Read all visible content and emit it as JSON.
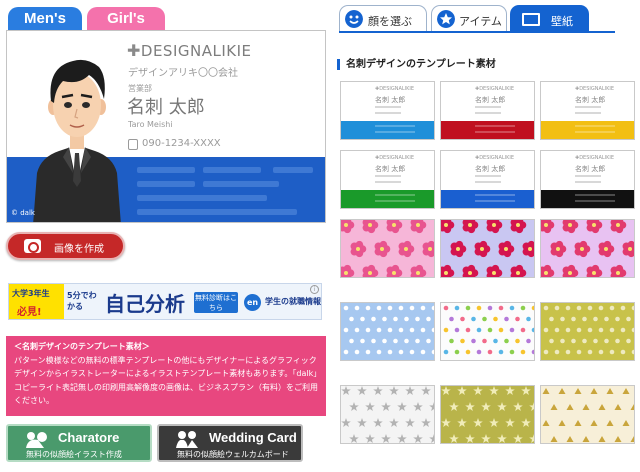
{
  "gender_tabs": {
    "men": "Men's",
    "girl": "Girl's"
  },
  "card": {
    "logo": "DESIGNALIKIE",
    "company": "デザインアリキ〇〇会社",
    "department": "営業部",
    "name": "名刺 太郎",
    "name_roman": "Taro Meishi",
    "tel": "090-1234-XXXX",
    "copyright": "© dalk",
    "band_color": "#1e5ec6"
  },
  "create_button": "画像を作成",
  "banner": {
    "badge_line1": "大学3年生",
    "badge_line2": "必見!",
    "prefix": "5分でわかる",
    "headline": "自己分析",
    "free_badge": "無料診断はこちら",
    "brand": "en",
    "tagline": "学生の就職情報",
    "info_icon": "i"
  },
  "info_box": {
    "title": "＜名刺デザインのテンプレート素材＞",
    "body": "パターン模様などの無料の標準テンプレートの他にもデザイナーによるグラフィックデザインからイラストレーターによるイラストテンプレート素材もあります。「dalk」コピーライト表記無しの印刷用高解像度の画像は、ビジネスプラン（有料）をご利用ください。"
  },
  "footer_buttons": [
    {
      "title": "Charatore",
      "subtitle": "無料の似顔絵イラスト作成"
    },
    {
      "title": "Wedding Card",
      "subtitle": "無料の似顔絵ウェルカムボード"
    }
  ],
  "right_tabs": [
    {
      "label": "顔を選ぶ",
      "icon": "smiley-icon"
    },
    {
      "label": "アイテム",
      "icon": "star-icon"
    },
    {
      "label": "壁紙",
      "icon": "monitor-icon",
      "active": true
    }
  ],
  "section_title": "名刺デザインのテンプレート素材",
  "thumbnails": [
    {
      "kind": "card",
      "band": "#1f8fd9"
    },
    {
      "kind": "card",
      "band": "#c0101f"
    },
    {
      "kind": "card",
      "band": "#f2bf13"
    },
    {
      "kind": "card",
      "band": "#1a9a2a"
    },
    {
      "kind": "card",
      "band": "#1a5fd0"
    },
    {
      "kind": "card",
      "band": "#111111"
    },
    {
      "kind": "pattern",
      "pattern": "pink-flower"
    },
    {
      "kind": "pattern",
      "pattern": "red-flower"
    },
    {
      "kind": "pattern",
      "pattern": "magenta-flower"
    },
    {
      "kind": "pattern",
      "pattern": "blue-dots"
    },
    {
      "kind": "pattern",
      "pattern": "confetti-dots"
    },
    {
      "kind": "pattern",
      "pattern": "olive-dots"
    },
    {
      "kind": "pattern",
      "pattern": "grey-stars"
    },
    {
      "kind": "pattern",
      "pattern": "olive-stars"
    },
    {
      "kind": "pattern",
      "pattern": "gold-triangles"
    }
  ],
  "thumb_mini": {
    "logo": "DESIGNALIKIE",
    "name": "名刺 太郎"
  }
}
